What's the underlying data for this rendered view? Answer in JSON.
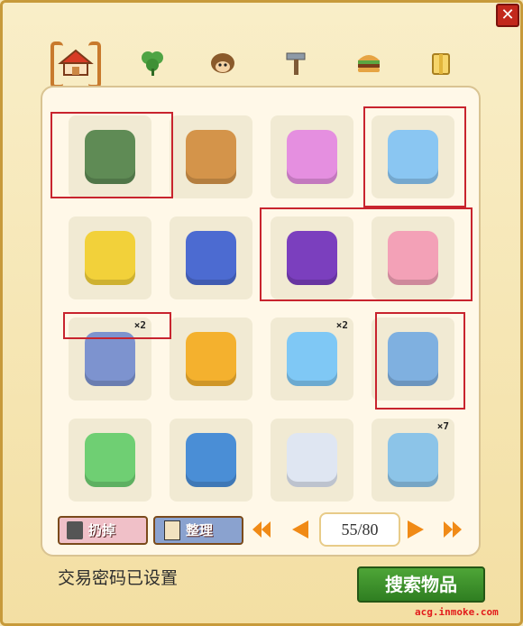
{
  "header": {
    "close_icon": "close-icon"
  },
  "tabs": [
    {
      "name": "home-icon",
      "active": true
    },
    {
      "name": "clover-icon"
    },
    {
      "name": "hedgehog-icon"
    },
    {
      "name": "hammer-icon"
    },
    {
      "name": "burger-icon"
    },
    {
      "name": "gift-icon"
    }
  ],
  "grid": {
    "rows": 4,
    "cols": 4,
    "items": [
      {
        "icon": "bento-box-icon",
        "highlight": true
      },
      {
        "icon": "bear-tank-icon",
        "highlight": false
      },
      {
        "icon": "cotton-candy-icon",
        "highlight": false
      },
      {
        "icon": "blue-candy-icon",
        "highlight": true
      },
      {
        "icon": "duck-bath-set-icon",
        "highlight": false
      },
      {
        "icon": "burger-sofa-icon",
        "highlight": false
      },
      {
        "icon": "purple-candy-icon",
        "highlight": true
      },
      {
        "icon": "pig-bed-icon",
        "highlight": true
      },
      {
        "icon": "rain-streamers-icon",
        "highlight": true,
        "qty": "×2"
      },
      {
        "icon": "cat-duck-costume-icon",
        "highlight": false
      },
      {
        "icon": "star-wand-icon",
        "highlight": false,
        "qty": "×2"
      },
      {
        "icon": "blue-gate-icon",
        "highlight": true
      },
      {
        "icon": "green-lantern-icon",
        "highlight": false
      },
      {
        "icon": "blue-feather-icon",
        "highlight": false
      },
      {
        "icon": "astronaut-icon",
        "highlight": false
      },
      {
        "icon": "snowy-tree-icon",
        "highlight": false,
        "qty": "×7"
      }
    ]
  },
  "actions": {
    "discard": "扔掉",
    "sort": "整理"
  },
  "pager": {
    "current": "55",
    "total": "80",
    "label": "55/80"
  },
  "footer": {
    "status": "交易密码已设置",
    "search": "搜索物品"
  },
  "watermark": "acg.inmoke.com"
}
